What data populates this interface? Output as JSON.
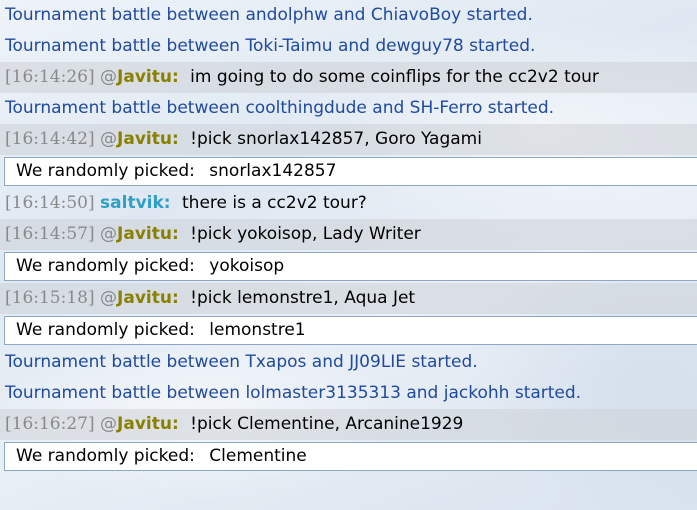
{
  "colors": {
    "notice": "#1f4aa0",
    "user_javitu": "#8a8000",
    "user_saltvik": "#2f9fc8",
    "timestamp": "#8a8a8a"
  },
  "chat": [
    {
      "kind": "notice",
      "text": "Tournament battle between andolphw and ChiavoBoy started."
    },
    {
      "kind": "notice",
      "text": "Tournament battle between Toki-Taimu and dewguy78 started."
    },
    {
      "kind": "chat",
      "highlight": true,
      "time": "[16:14:26]",
      "rank": "@",
      "user": "Javitu:",
      "message": "im going to do some coinflips for the cc2v2 tour"
    },
    {
      "kind": "notice",
      "text": "Tournament battle between coolthingdude and SH-Ferro started."
    },
    {
      "kind": "chat",
      "highlight": true,
      "time": "[16:14:42]",
      "rank": "@",
      "user": "Javitu:",
      "message": "!pick snorlax142857, Goro Yagami"
    },
    {
      "kind": "result",
      "label": "We randomly picked:",
      "value": "snorlax142857"
    },
    {
      "kind": "chat",
      "highlight": false,
      "time": "[16:14:50]",
      "rank": "",
      "user": "saltvik:",
      "message": "there is a cc2v2 tour?"
    },
    {
      "kind": "chat",
      "highlight": true,
      "time": "[16:14:57]",
      "rank": "@",
      "user": "Javitu:",
      "message": "!pick yokoisop, Lady Writer"
    },
    {
      "kind": "result",
      "label": "We randomly picked:",
      "value": "yokoisop"
    },
    {
      "kind": "chat",
      "highlight": true,
      "time": "[16:15:18]",
      "rank": "@",
      "user": "Javitu:",
      "message": "!pick lemonstre1, Aqua Jet"
    },
    {
      "kind": "result",
      "label": "We randomly picked:",
      "value": "lemonstre1"
    },
    {
      "kind": "notice",
      "text": "Tournament battle between Txapos and JJ09LIE started."
    },
    {
      "kind": "notice",
      "text": "Tournament battle between lolmaster3135313 and jackohh started."
    },
    {
      "kind": "chat",
      "highlight": true,
      "time": "[16:16:27]",
      "rank": "@",
      "user": "Javitu:",
      "message": "!pick Clementine, Arcanine1929"
    },
    {
      "kind": "result",
      "label": "We randomly picked:",
      "value": "Clementine"
    }
  ]
}
